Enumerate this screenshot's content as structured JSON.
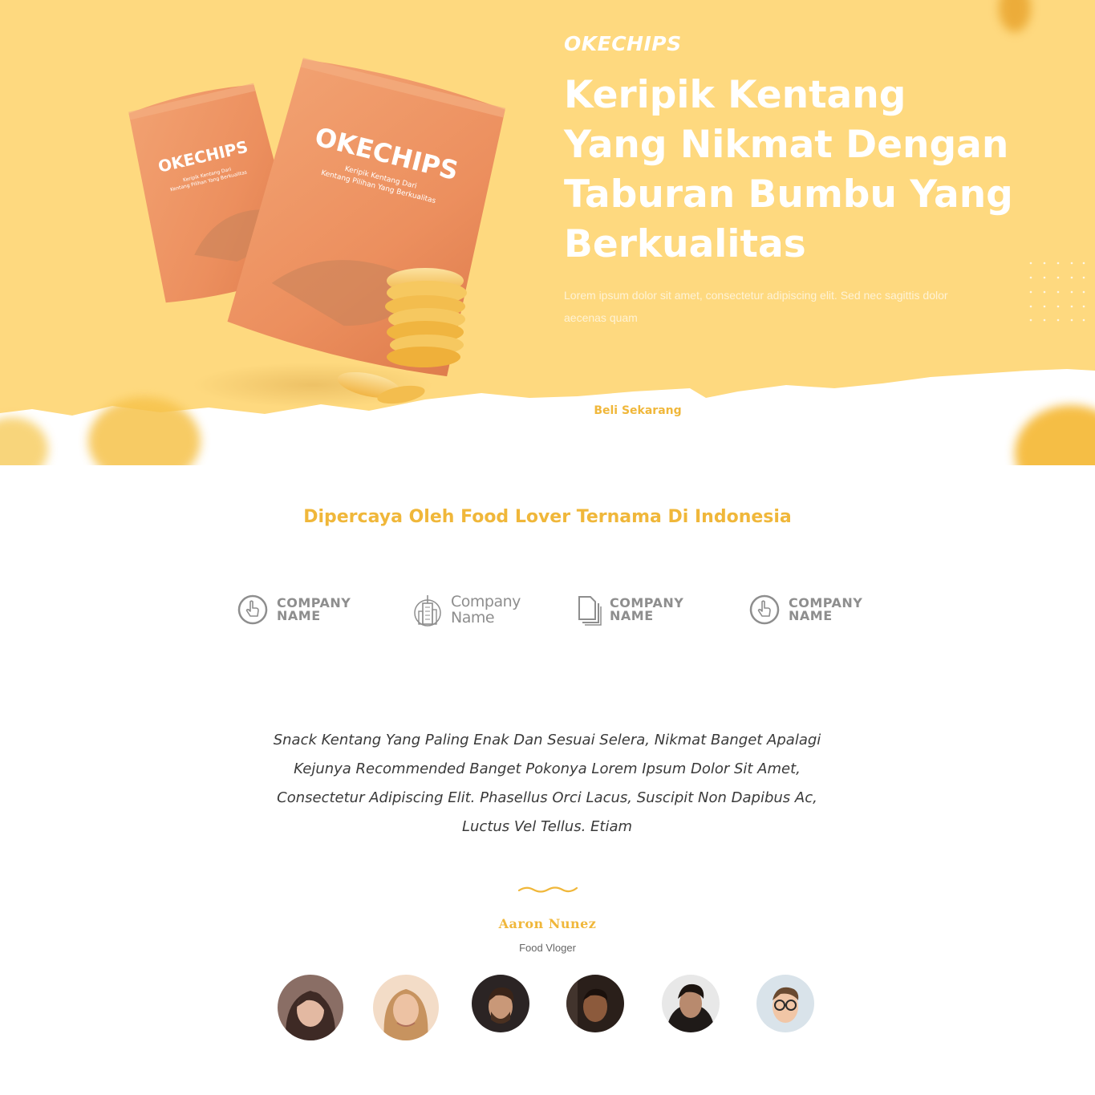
{
  "hero": {
    "brand": "OKECHIPS",
    "headline": "Keripik Kentang Yang Nikmat Dengan Taburan Bumbu Yang Berkualitas",
    "lead": "Lorem ipsum dolor sit amet, consectetur adipiscing elit. Sed nec sagittis dolor aecenas quam",
    "cta_label": "Beli Sekarang",
    "bag_small": {
      "brand": "OKECHIPS",
      "tagline_1": "Keripik Kentang Dari",
      "tagline_2": "Kentang Pilihan Yang Berkualitas"
    },
    "bag_large": {
      "brand": "OKECHIPS",
      "tagline_1": "Keripik Kentang Dari",
      "tagline_2": "Kentang Pilihan Yang Berkualitas"
    }
  },
  "trust": {
    "title": "Dipercaya Oleh Food Lover Ternama Di Indonesia",
    "logos": [
      {
        "icon": "pointer-hand-icon",
        "line1": "COMPANY",
        "line2": "NAME"
      },
      {
        "icon": "skyscraper-icon",
        "line1": "Company",
        "line2": "Name"
      },
      {
        "icon": "documents-icon",
        "line1": "COMPANY",
        "line2": "NAME"
      },
      {
        "icon": "pointer-hand-icon",
        "line1": "COMPANY",
        "line2": "NAME"
      }
    ]
  },
  "testimonial": {
    "quote": "Snack Kentang Yang Paling Enak Dan Sesuai Selera, Nikmat Banget Apalagi Kejunya Recommended Banget Pokonya Lorem Ipsum Dolor Sit Amet, Consectetur Adipiscing Elit. Phasellus Orci Lacus, Suscipit Non Dapibus Ac, Luctus Vel Tellus. Etiam",
    "name": "Aaron Nunez",
    "role": "Food Vloger",
    "avatars": [
      "avatar-1",
      "avatar-2",
      "avatar-3",
      "avatar-4",
      "avatar-5",
      "avatar-6"
    ]
  },
  "colors": {
    "hero_bg": "#FED97F",
    "accent": "#F0B73A",
    "bag": "#EE9262",
    "logo_gray": "#8E8E8E"
  }
}
